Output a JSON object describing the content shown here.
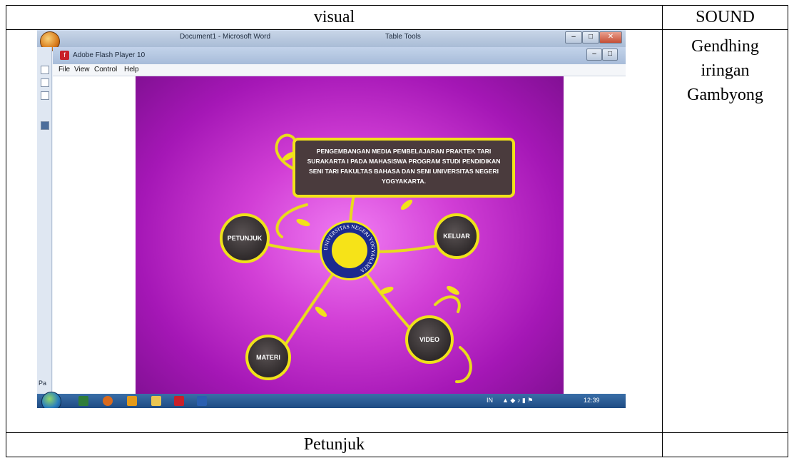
{
  "table": {
    "header_visual": "visual",
    "header_sound": "SOUND",
    "sound_lines": [
      "Gendhing",
      "iringan",
      "Gambyong"
    ],
    "caption": "Petunjuk"
  },
  "word_window": {
    "title": "Document1 - Microsoft Word",
    "contextual_tab": "Table Tools",
    "status_fragment": "Pa"
  },
  "flash_window": {
    "title": "Adobe Flash Player 10",
    "menu": [
      "File",
      "View",
      "Control",
      "Help"
    ]
  },
  "stage": {
    "title_text": "PENGEMBANGAN MEDIA PEMBELAJARAN PRAKTEK TARI SURAKARTA I PADA MAHASISWA PROGRAM STUDI PENDIDIKAN SENI TARI FAKULTAS BAHASA DAN SENI UNIVERSITAS NEGERI YOGYAKARTA.",
    "buttons": {
      "petunjuk": "PETUNJUK",
      "keluar": "KELUAR",
      "materi": "MATERI",
      "video": "VIDEO"
    },
    "logo_ring": "UNIVERSITAS NEGERI YOGYAKARTA"
  },
  "taskbar": {
    "language": "IN",
    "clock": "12:39"
  },
  "colors": {
    "accent_yellow": "#efe21a",
    "stage_magenta": "#d23fd6",
    "button_dark": "#3a3435"
  }
}
